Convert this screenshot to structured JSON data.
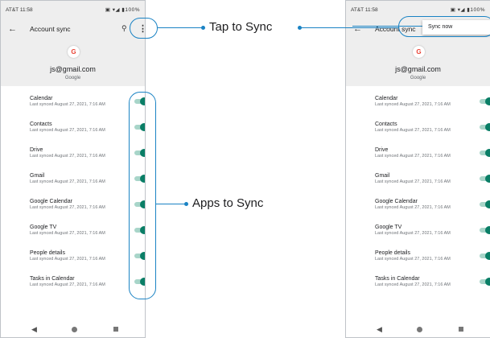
{
  "screens": {
    "left": {
      "carrier_time": "AT&T 11:58",
      "status_icons": "▣ ▾◢ ▮100%",
      "back_glyph": "←",
      "title": "Account sync",
      "search_glyph": "⚲",
      "more_glyph": "⋮",
      "account_logo": "G",
      "account_email": "js@gmail.com",
      "account_provider": "Google",
      "items": [
        {
          "name": "Calendar",
          "sub": "Last synced August 27, 2021, 7:16 AM",
          "enabled": true
        },
        {
          "name": "Contacts",
          "sub": "Last synced August 27, 2021, 7:16 AM",
          "enabled": true
        },
        {
          "name": "Drive",
          "sub": "Last synced August 27, 2021, 7:16 AM",
          "enabled": true
        },
        {
          "name": "Gmail",
          "sub": "Last synced August 27, 2021, 7:16 AM",
          "enabled": true
        },
        {
          "name": "Google Calendar",
          "sub": "Last synced August 27, 2021, 7:16 AM",
          "enabled": true
        },
        {
          "name": "Google TV",
          "sub": "Last synced August 27, 2021, 7:16 AM",
          "enabled": true
        },
        {
          "name": "People details",
          "sub": "Last synced August 27, 2021, 7:16 AM",
          "enabled": true
        },
        {
          "name": "Tasks in Calendar",
          "sub": "Last synced August 27, 2021, 7:16 AM",
          "enabled": true
        }
      ]
    },
    "right": {
      "carrier_time": "AT&T 11:58",
      "status_icons": "▣ ▾◢ ▮100%",
      "back_glyph": "←",
      "title": "Account sync",
      "popup_item": "Sync now",
      "account_logo": "G",
      "account_email": "js@gmail.com",
      "account_provider": "Google",
      "items": [
        {
          "name": "Calendar",
          "sub": "Last synced August 27, 2021, 7:16 AM",
          "enabled": true
        },
        {
          "name": "Contacts",
          "sub": "Last synced August 27, 2021, 7:16 AM",
          "enabled": true
        },
        {
          "name": "Drive",
          "sub": "Last synced August 27, 2021, 7:16 AM",
          "enabled": true
        },
        {
          "name": "Gmail",
          "sub": "Last synced August 27, 2021, 7:16 AM",
          "enabled": true
        },
        {
          "name": "Google Calendar",
          "sub": "Last synced August 27, 2021, 7:16 AM",
          "enabled": true
        },
        {
          "name": "Google TV",
          "sub": "Last synced August 27, 2021, 7:16 AM",
          "enabled": true
        },
        {
          "name": "People details",
          "sub": "Last synced August 27, 2021, 7:16 AM",
          "enabled": true
        },
        {
          "name": "Tasks in Calendar",
          "sub": "Last synced August 27, 2021, 7:16 AM",
          "enabled": true
        }
      ]
    }
  },
  "nav": {
    "back": "◀",
    "home": "●",
    "recent": "■"
  },
  "callouts": {
    "tap_to_sync": "Tap to Sync",
    "apps_to_sync": "Apps to Sync"
  },
  "colors": {
    "accent": "#1a83c4",
    "toggle_on": "#0a7e66",
    "toggle_track": "#a8d5c9",
    "header_bg": "#eeeeee"
  },
  "icons": {
    "back": "arrow-back-icon",
    "search": "search-icon",
    "more": "more-vert-icon",
    "google": "google-logo-icon"
  }
}
